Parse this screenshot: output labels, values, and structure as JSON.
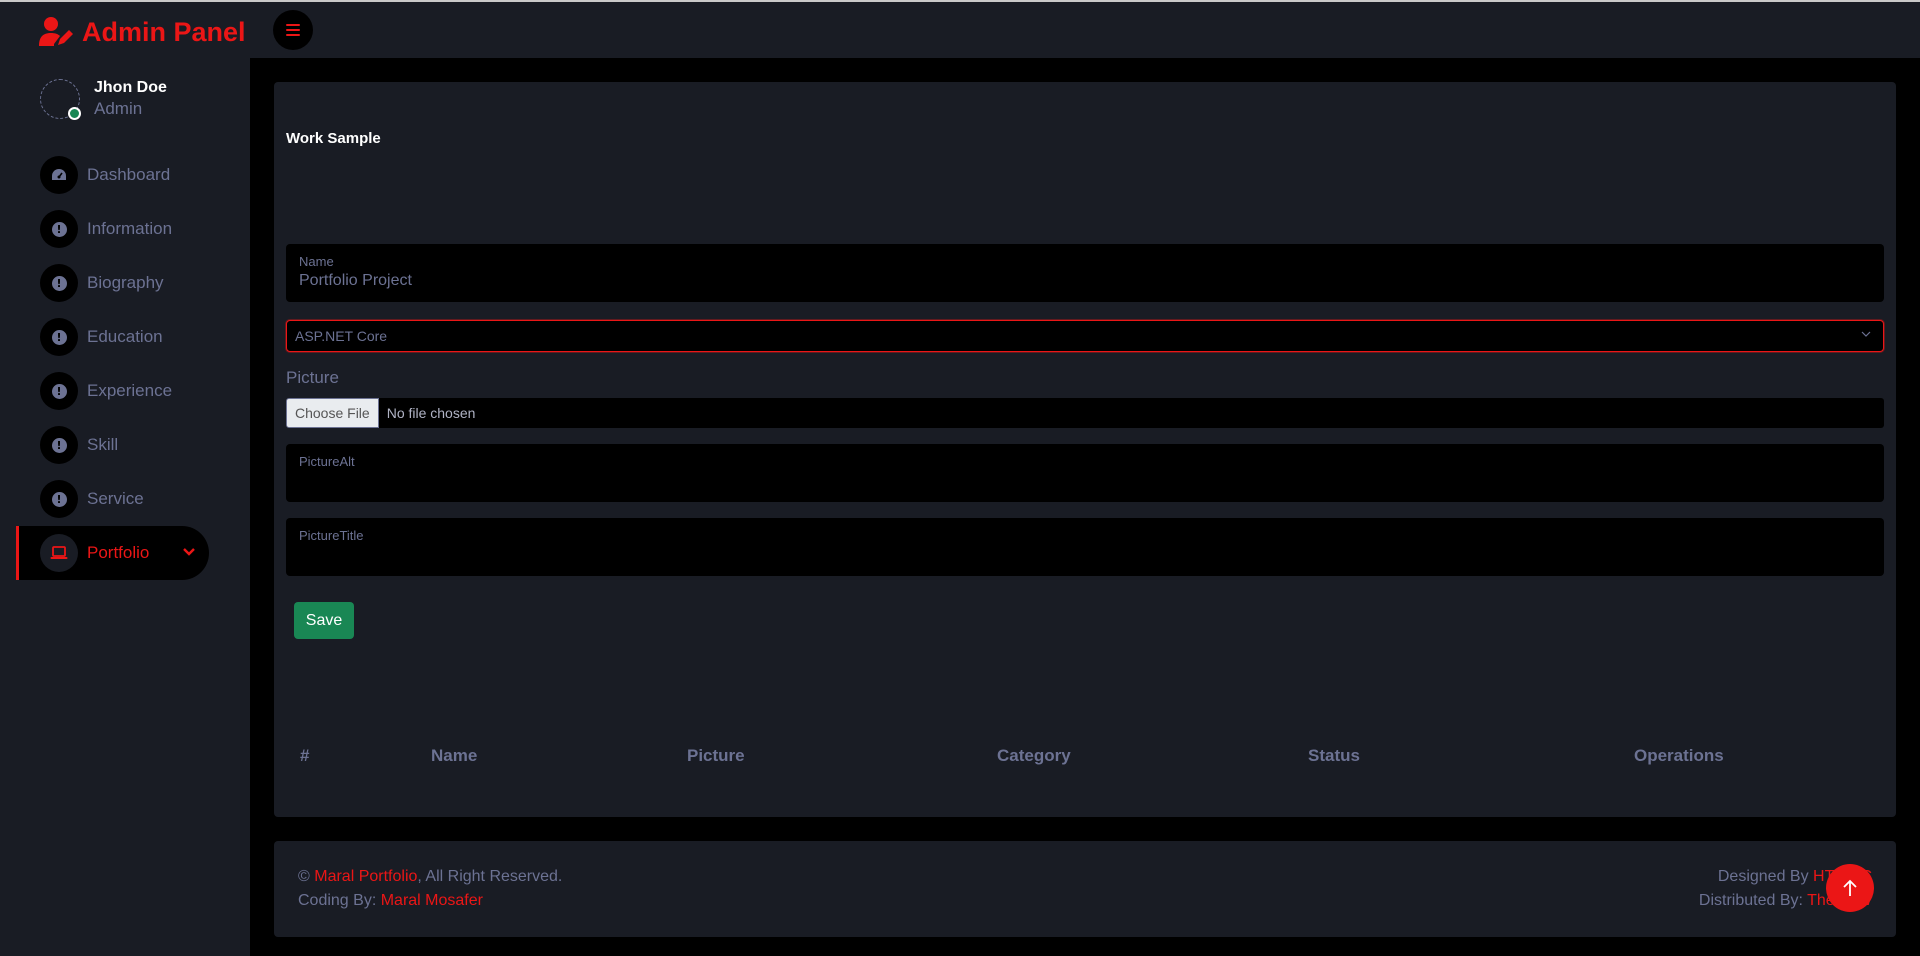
{
  "brand": {
    "title": "Admin Panel",
    "icon": "user-edit-icon"
  },
  "profile": {
    "name": "Jhon Doe",
    "role": "Admin"
  },
  "sidebar": {
    "items": [
      {
        "label": "Dashboard",
        "icon": "tachometer-icon"
      },
      {
        "label": "Information",
        "icon": "info-icon"
      },
      {
        "label": "Biography",
        "icon": "info-icon"
      },
      {
        "label": "Education",
        "icon": "info-icon"
      },
      {
        "label": "Experience",
        "icon": "info-icon"
      },
      {
        "label": "Skill",
        "icon": "info-icon"
      },
      {
        "label": "Service",
        "icon": "info-icon"
      },
      {
        "label": "Portfolio",
        "icon": "laptop-icon",
        "active": true
      }
    ]
  },
  "form": {
    "title": "Work Sample",
    "name_label": "Name",
    "name_value": "Portfolio Project",
    "category_selected": "ASP.NET Core",
    "picture_label": "Picture",
    "choose_file": "Choose File",
    "no_file": "No file chosen",
    "picture_alt_label": "PictureAlt",
    "picture_title_label": "PictureTitle",
    "save_label": "Save"
  },
  "table": {
    "headers": [
      "#",
      "Name",
      "Picture",
      "Category",
      "Status",
      "Operations"
    ]
  },
  "footer": {
    "copyright_symbol": "©",
    "site_name": "Maral Portfolio",
    "rights": ", All Right Reserved.",
    "coding_by_label": "Coding By: ",
    "coder": "Maral Mosafer",
    "designed_by_label": "Designed By ",
    "designer": "HTML C",
    "distributed_by_label": "Distributed By: ",
    "distributor": "ThemeW"
  },
  "colors": {
    "accent": "#eb1616",
    "sidebar_bg": "#191c24",
    "page_bg": "#000000",
    "muted_text": "#6c7293",
    "success": "#198754"
  }
}
